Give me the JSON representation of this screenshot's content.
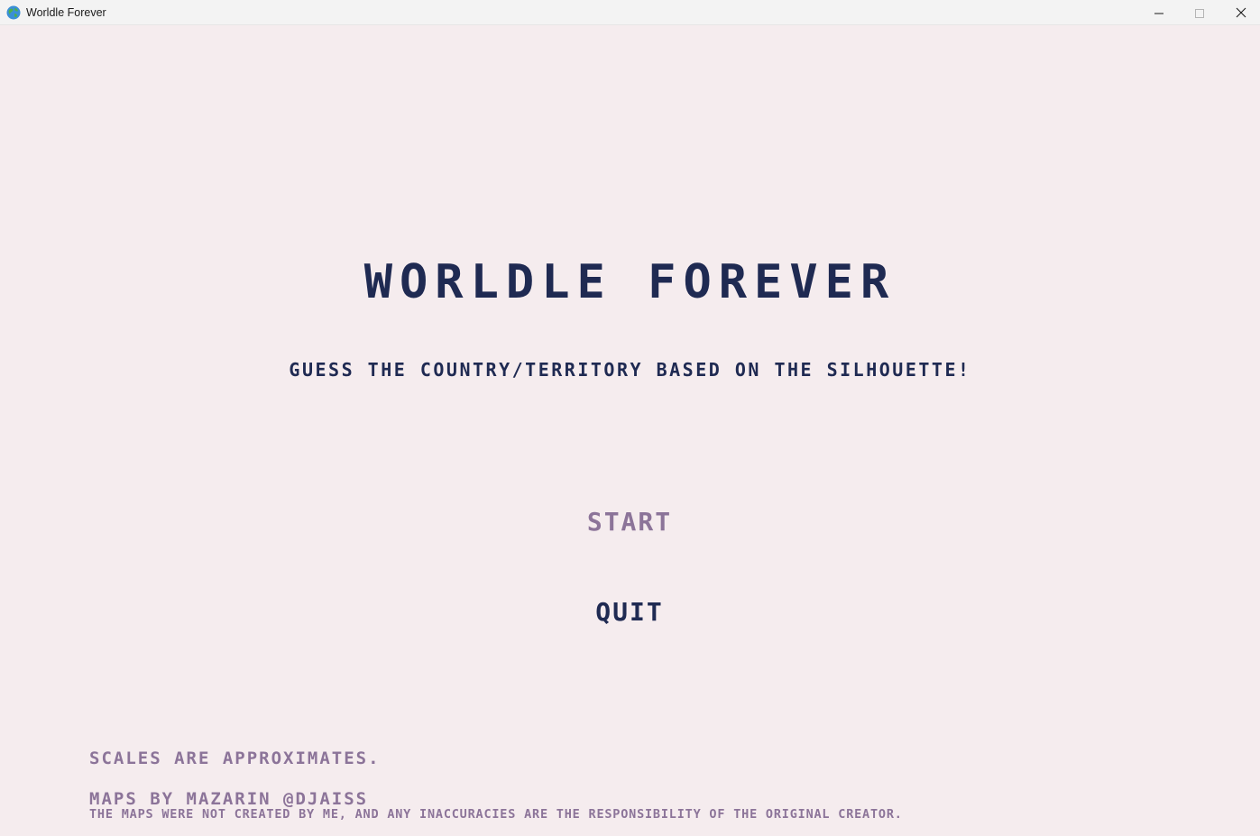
{
  "window": {
    "title": "Worldle Forever"
  },
  "game": {
    "title": "WORLDLE FOREVER",
    "subtitle": "GUESS THE COUNTRY/TERRITORY BASED ON THE SILHOUETTE!",
    "menu": {
      "start_label": "START",
      "quit_label": "QUIT"
    },
    "footer": {
      "scales_note": "SCALES ARE APPROXIMATES.",
      "maps_credit": "MAPS BY MAZARIN @DJAISS",
      "disclaimer": "THE MAPS WERE NOT CREATED BY ME, AND ANY INACCURACIES ARE THE RESPONSIBILITY OF THE ORIGINAL CREATOR."
    }
  },
  "colors": {
    "background": "#f5ecee",
    "primary_text": "#1f2a52",
    "muted_text": "#8c7499"
  },
  "icons": {
    "app": "globe-icon",
    "minimize": "minimize-icon",
    "maximize": "maximize-icon",
    "close": "close-icon"
  }
}
